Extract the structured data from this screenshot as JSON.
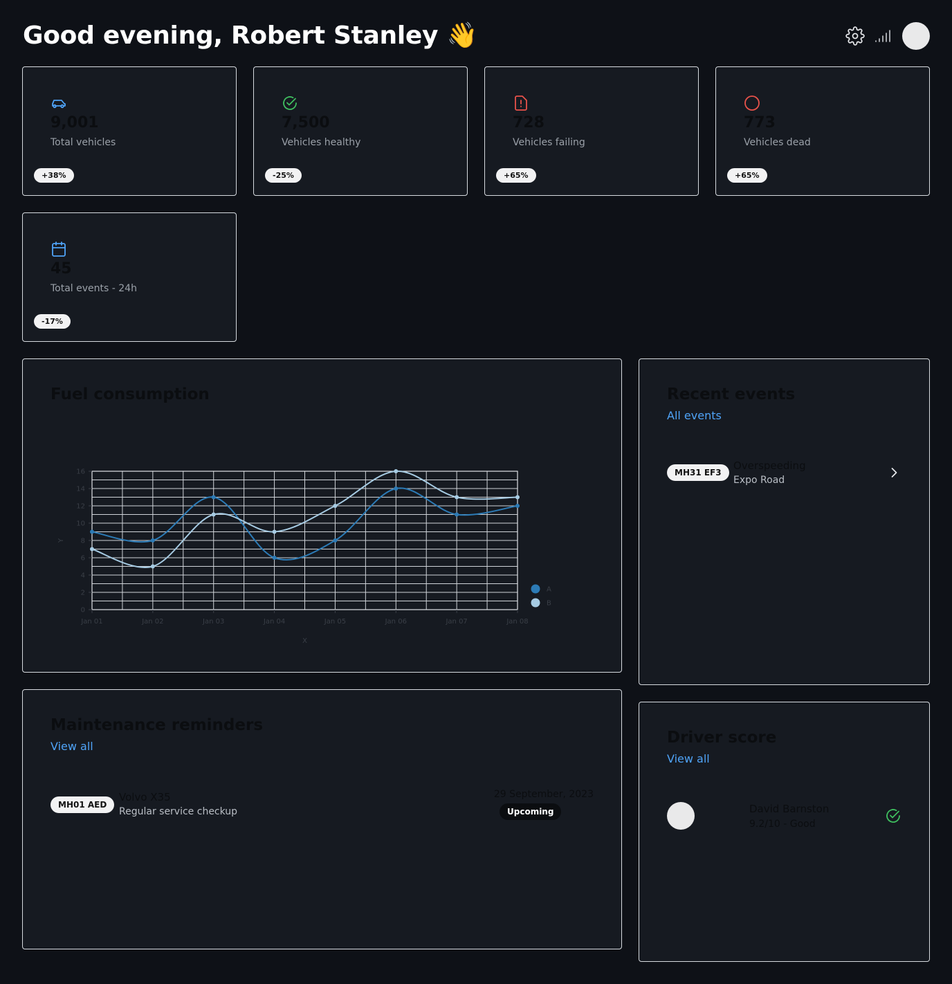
{
  "header": {
    "greeting": "Good evening, Robert Stanley",
    "wave_emoji": "👋",
    "icons": [
      "gear-icon",
      "signal-icon"
    ]
  },
  "stats": [
    {
      "icon": "car-icon",
      "icon_color": "#4fa3f7",
      "value": "9,001",
      "label": "Total vehicles",
      "change": "+38%"
    },
    {
      "icon": "check-circle-icon",
      "icon_color": "#3fbf5f",
      "value": "7,500",
      "label": "Vehicles healthy",
      "change": "-25%"
    },
    {
      "icon": "file-alert-icon",
      "icon_color": "#e8524a",
      "value": "728",
      "label": "Vehicles failing",
      "change": "+65%"
    },
    {
      "icon": "circle-icon",
      "icon_color": "#e8524a",
      "value": "773",
      "label": "Vehicles dead",
      "change": "+65%"
    },
    {
      "icon": "calendar-icon",
      "icon_color": "#4fa3f7",
      "value": "45",
      "label": "Total events - 24h",
      "change": "-17%"
    }
  ],
  "fuel": {
    "title": "Fuel consumption"
  },
  "chart_data": {
    "type": "line",
    "x": [
      "Jan 01",
      "Jan 02",
      "Jan 03",
      "Jan 04",
      "Jan 05",
      "Jan 06",
      "Jan 07",
      "Jan 08"
    ],
    "series": [
      {
        "name": "A",
        "color": "#2c7bb6",
        "values": [
          9,
          8,
          13,
          6,
          8,
          14,
          11,
          12
        ]
      },
      {
        "name": "B",
        "color": "#a6cbe3",
        "values": [
          7,
          5,
          11,
          9,
          12,
          16,
          13,
          13
        ]
      }
    ],
    "yticks": [
      0,
      2,
      4,
      6,
      8,
      10,
      12,
      14,
      16
    ],
    "ylim": [
      0,
      16
    ],
    "xlabel": "X",
    "ylabel": "Y",
    "grid": true,
    "legend": "right"
  },
  "recent_events": {
    "title": "Recent events",
    "link": "All events",
    "items": [
      {
        "plate": "MH31 EF3",
        "event": "Overspeeding",
        "location": "Expo Road"
      }
    ]
  },
  "maintenance": {
    "title": "Maintenance reminders",
    "link": "View all",
    "items": [
      {
        "plate": "MH01 AED",
        "vehicle": "Volvo X35",
        "task": "Regular service checkup",
        "date": "29 September, 2023",
        "status": "Upcoming"
      }
    ]
  },
  "driver_score": {
    "title": "Driver score",
    "link": "View all",
    "items": [
      {
        "name": "David Barnston",
        "score": "9.2/10 - Good"
      }
    ]
  }
}
